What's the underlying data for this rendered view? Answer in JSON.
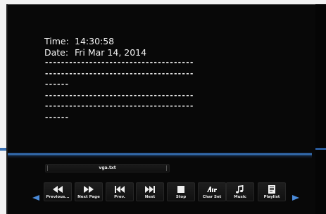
{
  "info": {
    "time_label": "Time:",
    "time_value": "14:30:58",
    "date_label": "Date:",
    "date_value": "Fri Mar 14, 2014"
  },
  "text_lines": [
    "-------------------------------------",
    "-------------------------------------",
    "------",
    "-------------------------------------",
    "-------------------------------------",
    "------"
  ],
  "file": {
    "name": "vga.txt"
  },
  "controls": {
    "previous": "Previous...",
    "next_page": "Next Page",
    "prev": "Prev.",
    "next": "Next",
    "stop": "Stop",
    "char_set": "Char Set",
    "music": "Music",
    "playlist": "Playlist"
  },
  "colors": {
    "accent": "#3c79c0",
    "nav_arrow": "#4a8ad8",
    "text": "#f2f2f2",
    "background": "#080808"
  },
  "icons": {
    "nav_left": "triangle-left-icon",
    "nav_right": "triangle-right-icon",
    "previous": "rewind-icon",
    "next_page": "fast-forward-icon",
    "prev": "skip-back-icon",
    "next": "skip-forward-icon",
    "stop": "stop-icon",
    "char_set": "char-set-icon",
    "music": "music-note-icon",
    "playlist": "playlist-icon"
  }
}
